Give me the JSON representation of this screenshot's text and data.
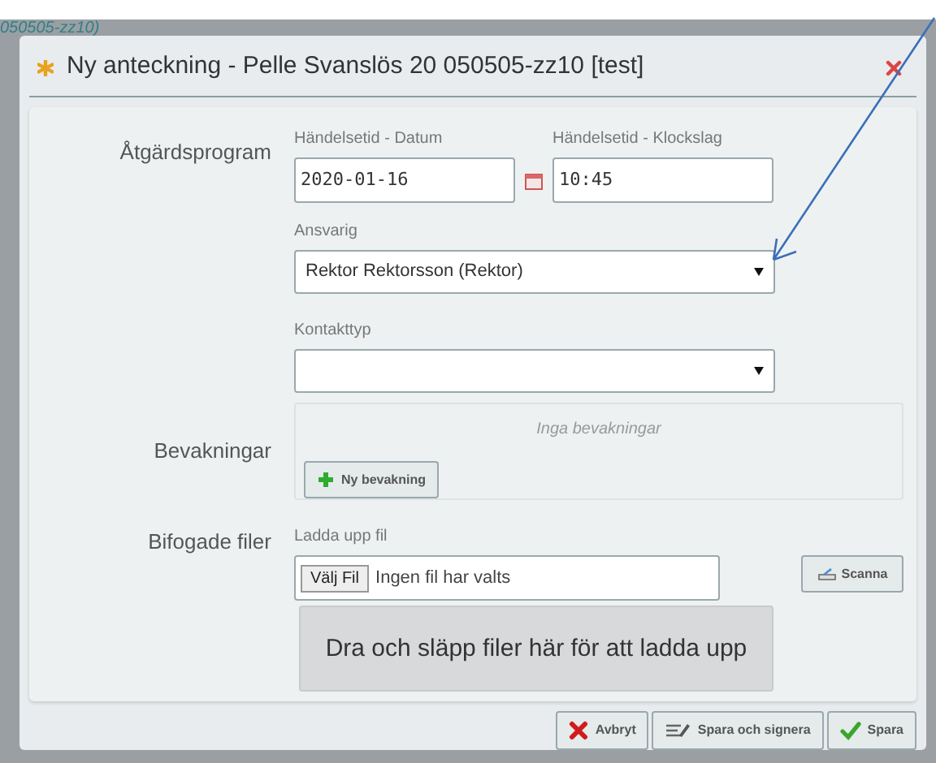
{
  "background": {
    "header_text": "050505-zz10)"
  },
  "dialog": {
    "title": "Ny anteckning - Pelle Svanslös 20 050505-zz10 [test]",
    "sections": [
      {
        "label": "Åtgärdsprogram",
        "date_label": "Händelsetid - Datum",
        "date_value": "2020-01-16",
        "time_label": "Händelsetid - Klockslag",
        "time_value": "10:45",
        "responsible_label": "Ansvarig",
        "responsible_value": "Rektor Rektorsson (Rektor)",
        "contact_label": "Kontakttyp"
      },
      {
        "label": "Bevakningar",
        "empty_text": "Inga bevakningar",
        "add_button": "Ny bevakning"
      },
      {
        "label": "Bifogade filer",
        "upload_label": "Ladda upp fil",
        "choose_button": "Välj Fil",
        "no_file_text": "Ingen fil har valts",
        "scan_button": "Scanna",
        "dropzone_text": "Dra och släpp filer här för att ladda upp"
      }
    ],
    "footer_buttons": [
      {
        "kind": "cancel",
        "label": "Avbryt"
      },
      {
        "kind": "sign",
        "label": "Spara och signera"
      },
      {
        "kind": "save",
        "label": "Spara"
      }
    ]
  }
}
